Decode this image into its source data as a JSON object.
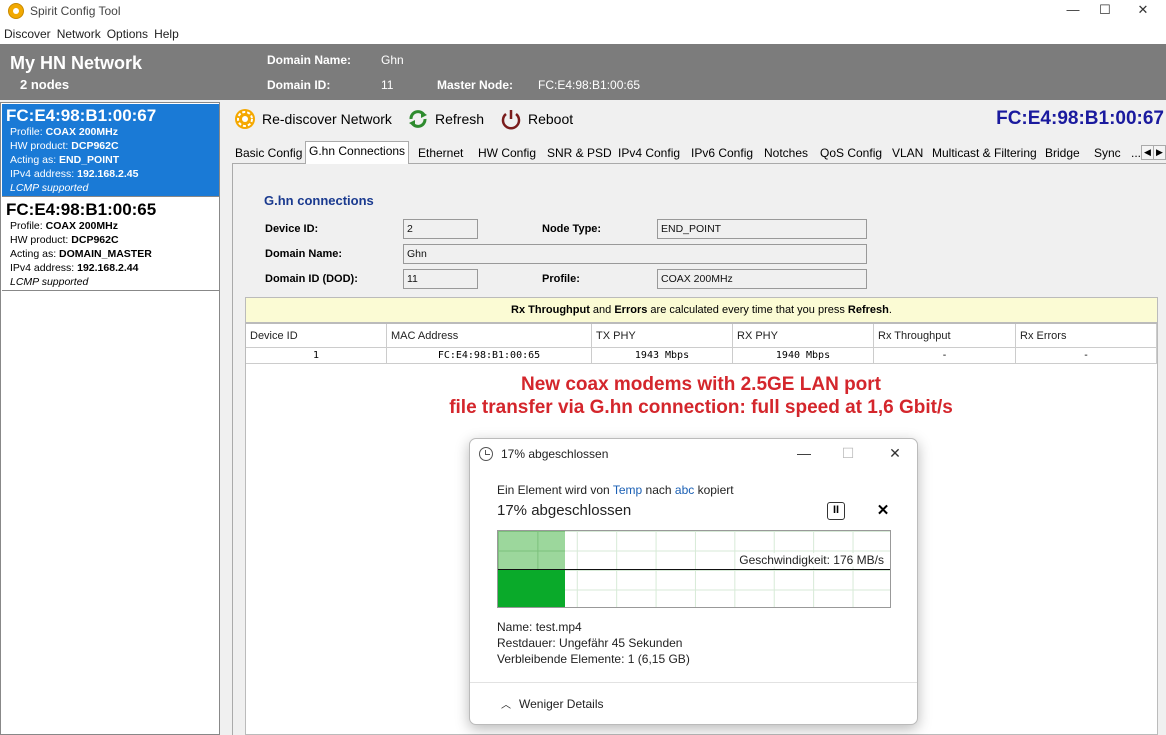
{
  "window": {
    "title": "Spirit Config Tool",
    "icon": "gear-icon",
    "controls": {
      "minimize": "—",
      "maximize": "☐",
      "close": "✕"
    }
  },
  "menu": [
    "Discover",
    "Network",
    "Options",
    "Help"
  ],
  "header": {
    "network_title": "My HN Network",
    "nodes_count": "2 nodes",
    "domain_name_label": "Domain Name:",
    "domain_name_value": "Ghn",
    "domain_id_label": "Domain ID:",
    "domain_id_value": "11",
    "master_node_label": "Master Node:",
    "master_node_value": "FC:E4:98:B1:00:65"
  },
  "nodes": [
    {
      "mac": "FC:E4:98:B1:00:67",
      "profile_label": "Profile:",
      "profile": "COAX 200MHz",
      "hw_label": "HW product:",
      "hw": "DCP962C",
      "acting_label": "Acting as:",
      "acting": "END_POINT",
      "ip_label": "IPv4 address:",
      "ip": "192.168.2.45",
      "lcmp": "LCMP supported"
    },
    {
      "mac": "FC:E4:98:B1:00:65",
      "profile_label": "Profile:",
      "profile": "COAX 200MHz",
      "hw_label": "HW product:",
      "hw": "DCP962C",
      "acting_label": "Acting as:",
      "acting": "DOMAIN_MASTER",
      "ip_label": "IPv4 address:",
      "ip": "192.168.2.44",
      "lcmp": "LCMP supported"
    }
  ],
  "toolbar": {
    "rediscover": "Re-discover Network",
    "refresh": "Refresh",
    "reboot": "Reboot",
    "selected_mac": "FC:E4:98:B1:00:67"
  },
  "tabs": [
    "Basic Config",
    "G.hn Connections",
    "Ethernet",
    "HW Config",
    "SNR & PSD",
    "IPv4 Config",
    "IPv6 Config",
    "Notches",
    "QoS Config",
    "VLAN",
    "Multicast & Filtering",
    "Bridge",
    "Sync",
    "..."
  ],
  "panel": {
    "section_title": "G.hn connections",
    "device_id_label": "Device ID:",
    "device_id": "2",
    "node_type_label": "Node Type:",
    "node_type": "END_POINT",
    "domain_name_label": "Domain Name:",
    "domain_name": "Ghn",
    "domain_id_label": "Domain ID (DOD):",
    "domain_id": "11",
    "profile_label": "Profile:",
    "profile": "COAX 200MHz",
    "note_b1": "Rx Throughput",
    "note_t1": " and ",
    "note_b2": "Errors",
    "note_t2": " are calculated every time that you press ",
    "note_b3": "Refresh",
    "note_t3": "."
  },
  "table": {
    "headers": [
      "Device ID",
      "MAC Address",
      "TX PHY",
      "RX PHY",
      "Rx Throughput",
      "Rx Errors"
    ],
    "rows": [
      [
        "1",
        "FC:E4:98:B1:00:65",
        "1943 Mbps",
        "1940 Mbps",
        "-",
        "-"
      ]
    ]
  },
  "overlay": {
    "line1": "New coax modems with 2.5GE LAN port",
    "line2": "file transfer via G.hn connection: full speed at 1,6 Gbit/s",
    "color": "#d4262c"
  },
  "dialog": {
    "title": "17% abgeschlossen",
    "controls": {
      "minimize": "—",
      "maximize": "☐",
      "close": "✕"
    },
    "copy_text_1": "Ein Element wird von ",
    "copy_from": "Temp",
    "copy_text_2": " nach ",
    "copy_to": "abc",
    "copy_text_3": " kopiert",
    "progress_text": "17% abgeschlossen",
    "progress_fraction": 0.17,
    "pause": "II",
    "cancel": "✕",
    "speed": "Geschwindigkeit: 176 MB/s",
    "name_label": "Name:",
    "name": "test.mp4",
    "remaining_label": "Restdauer:",
    "remaining": "Ungefähr 45 Sekunden",
    "items_label": "Verbleibende Elemente:",
    "items": "1 (6,15 GB)",
    "less_details": "Weniger Details"
  }
}
